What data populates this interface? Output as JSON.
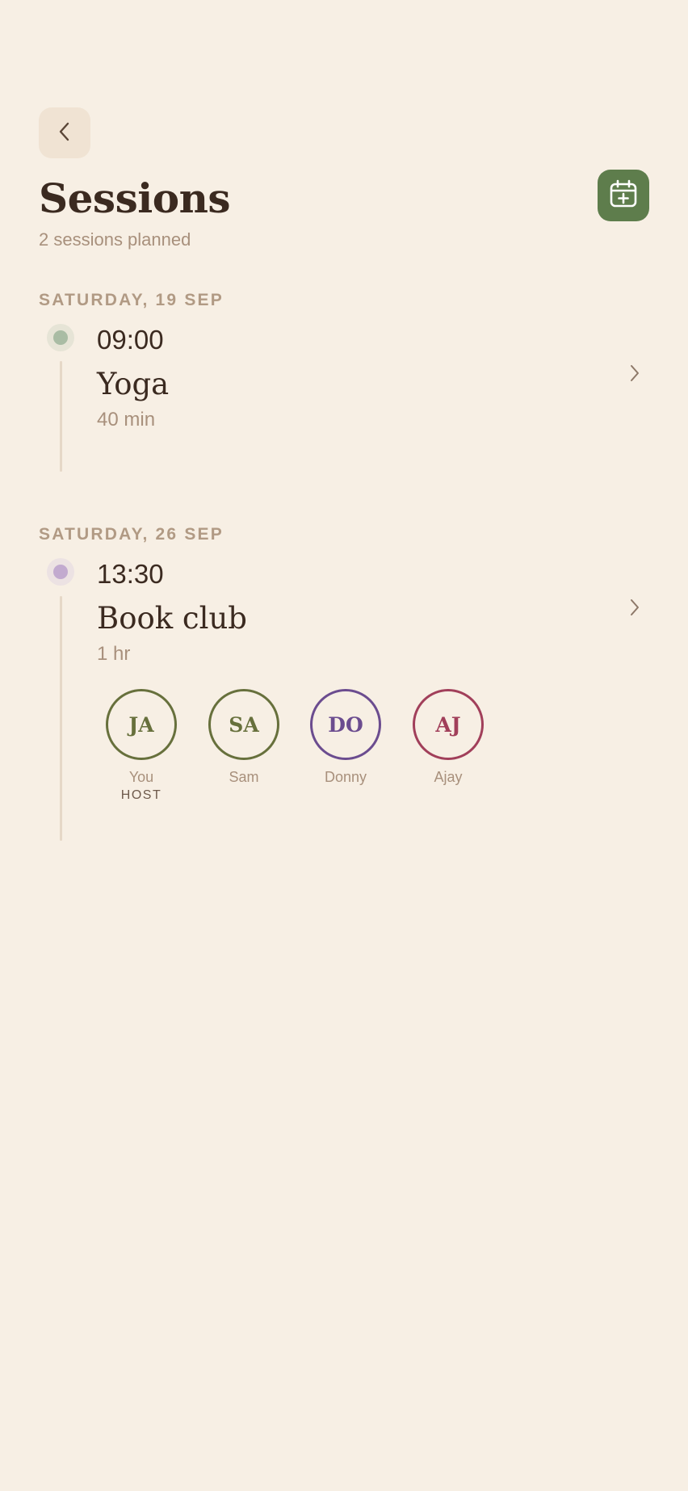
{
  "header": {
    "title": "Sessions",
    "subtitle": "2 sessions planned",
    "back_icon": "chevron-left-icon",
    "add_icon": "calendar-add-icon"
  },
  "colors": {
    "background": "#f7efe4",
    "accent_green": "#5e7d4c",
    "text_dark": "#3b2a20",
    "text_muted": "#a8907c"
  },
  "days": [
    {
      "label": "SATURDAY, 19 SEP",
      "sessions": [
        {
          "time": "09:00",
          "name": "Yoga",
          "duration": "40 min",
          "dot_color": "#a9bca4",
          "dot_ring": "#e6e4d6"
        }
      ]
    },
    {
      "label": "SATURDAY, 26 SEP",
      "sessions": [
        {
          "time": "13:30",
          "name": "Book club",
          "duration": "1 hr",
          "dot_color": "#c2aacf",
          "dot_ring": "#ece2e3",
          "attendees": [
            {
              "initials": "JA",
              "name": "You",
              "role": "HOST",
              "color": "#67703c"
            },
            {
              "initials": "SA",
              "name": "Sam",
              "color": "#67703c"
            },
            {
              "initials": "DO",
              "name": "Donny",
              "color": "#6b4c8f"
            },
            {
              "initials": "AJ",
              "name": "Ajay",
              "color": "#a13f5a"
            }
          ]
        }
      ]
    }
  ]
}
